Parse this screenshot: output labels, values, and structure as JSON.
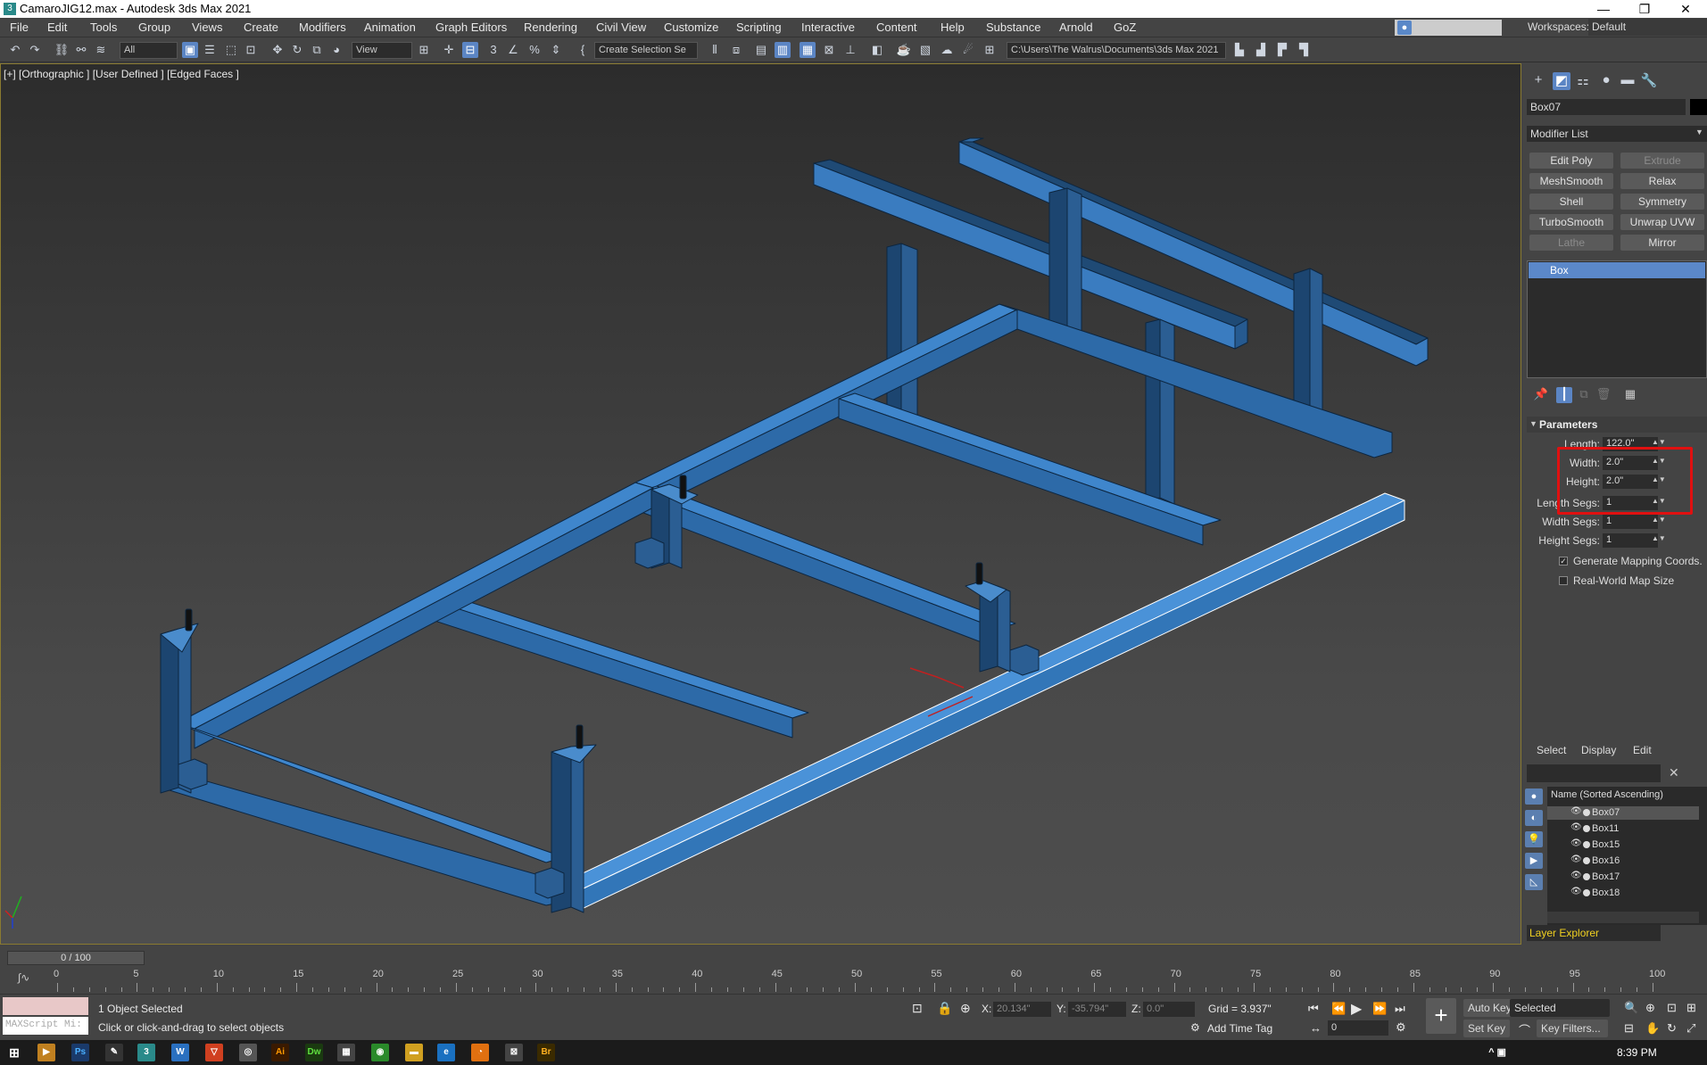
{
  "window": {
    "title": "CamaroJIG12.max - Autodesk 3ds Max 2021",
    "app_icon": "3",
    "min": "—",
    "max": "❐",
    "close": "✕"
  },
  "menu": [
    "File",
    "Edit",
    "Tools",
    "Group",
    "Views",
    "Create",
    "Modifiers",
    "Animation",
    "Graph Editors",
    "Rendering",
    "Civil View",
    "Customize",
    "Scripting",
    "Interactive",
    "Content",
    "Help",
    "Substance",
    "Arnold",
    "GoZ"
  ],
  "workspace": {
    "label": "Workspaces:",
    "value": "Default"
  },
  "toolbar": {
    "filter": "All",
    "refcoord": "View",
    "selset": "Create Selection Se",
    "path": "C:\\Users\\The Walrus\\Documents\\3ds Max 2021"
  },
  "viewport": {
    "label": "[+] [Orthographic ] [User Defined ] [Edged Faces ]"
  },
  "command_panel": {
    "object_name": "Box07",
    "modifier_list": "Modifier List",
    "modifiers": [
      "Edit Poly",
      "Extrude",
      "MeshSmooth",
      "Relax",
      "Shell",
      "Symmetry",
      "TurboSmooth",
      "Unwrap UVW",
      "Lathe",
      "Mirror"
    ],
    "stack_item": "Box",
    "rollout_title": "Parameters",
    "params": [
      {
        "label": "Length:",
        "value": "122.0\""
      },
      {
        "label": "Width:",
        "value": "2.0\""
      },
      {
        "label": "Height:",
        "value": "2.0\""
      },
      {
        "label": "Length Segs:",
        "value": "1"
      },
      {
        "label": "Width Segs:",
        "value": "1"
      },
      {
        "label": "Height Segs:",
        "value": "1"
      }
    ],
    "gen_mapping": "Generate Mapping Coords.",
    "real_world": "Real-World Map Size"
  },
  "scene_explorer": {
    "tabs": [
      "Select",
      "Display",
      "Edit"
    ],
    "column": "Name (Sorted Ascending)",
    "items": [
      "Box07",
      "Box11",
      "Box15",
      "Box16",
      "Box17",
      "Box18"
    ],
    "layer": "Layer Explorer"
  },
  "timeline": {
    "frame": "0 / 100",
    "ticks": [
      "0",
      "5",
      "10",
      "15",
      "20",
      "25",
      "30",
      "35",
      "40",
      "45",
      "50",
      "55",
      "60",
      "65",
      "70",
      "75",
      "80",
      "85",
      "90",
      "95",
      "100"
    ]
  },
  "status": {
    "maxscript": "MAXScript Mi:",
    "selected": "1 Object Selected",
    "prompt": "Click or click-and-drag to select objects",
    "x_label": "X:",
    "x": "20.134\"",
    "y_label": "Y:",
    "y": "-35.794\"",
    "z_label": "Z:",
    "z": "0.0\"",
    "grid": "Grid = 3.937\"",
    "add_time_tag": "Add Time Tag",
    "auto_key": "Auto Key",
    "selected_dd": "Selected",
    "set_key": "Set Key",
    "key_filters": "Key Filters...",
    "frame_field": "0"
  },
  "taskbar": {
    "time": "8:39 PM"
  }
}
